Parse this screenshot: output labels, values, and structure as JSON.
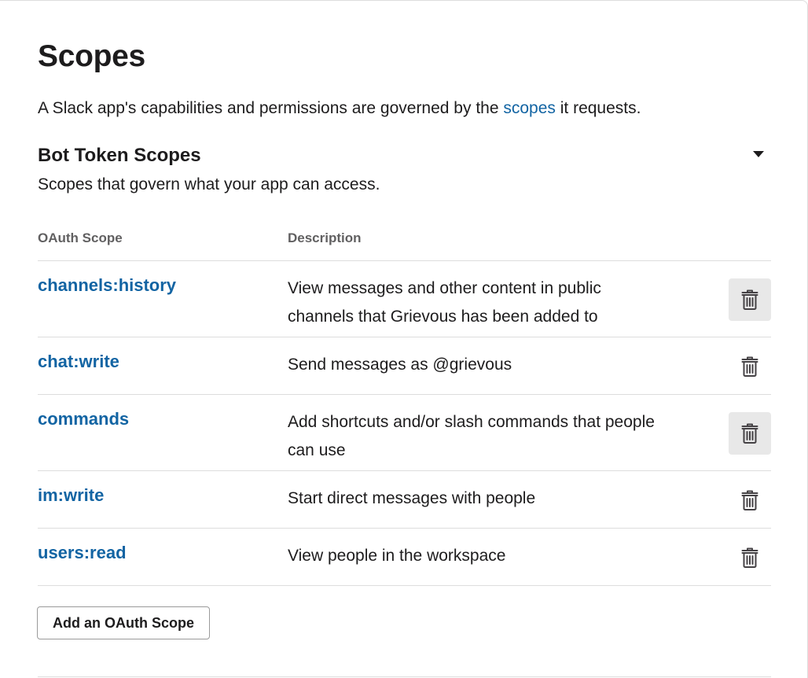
{
  "header": {
    "title": "Scopes",
    "intro_before": "A Slack app's capabilities and permissions are governed by the ",
    "intro_link": "scopes",
    "intro_after": " it requests."
  },
  "section": {
    "title": "Bot Token Scopes",
    "subtitle": "Scopes that govern what your app can access.",
    "toggle_icon": "caret-down-icon"
  },
  "table": {
    "columns": [
      "OAuth Scope",
      "Description"
    ],
    "rows": [
      {
        "scope": "channels:history",
        "description": "View messages and other content in public channels that Grievous has been added to",
        "delete_icon": "trash-icon",
        "hovered": true
      },
      {
        "scope": "chat:write",
        "description": "Send messages as @grievous",
        "delete_icon": "trash-icon",
        "hovered": false
      },
      {
        "scope": "commands",
        "description": "Add shortcuts and/or slash commands that people can use",
        "delete_icon": "trash-icon",
        "hovered": true
      },
      {
        "scope": "im:write",
        "description": "Start direct messages with people",
        "delete_icon": "trash-icon",
        "hovered": false
      },
      {
        "scope": "users:read",
        "description": "View people in the workspace",
        "delete_icon": "trash-icon",
        "hovered": false
      }
    ]
  },
  "actions": {
    "add_scope_label": "Add an OAuth Scope"
  },
  "colors": {
    "link": "#1264a3",
    "text": "#1d1c1d",
    "muted": "#616061",
    "divider": "#dddddd",
    "hover_bg": "#e8e8e8"
  }
}
